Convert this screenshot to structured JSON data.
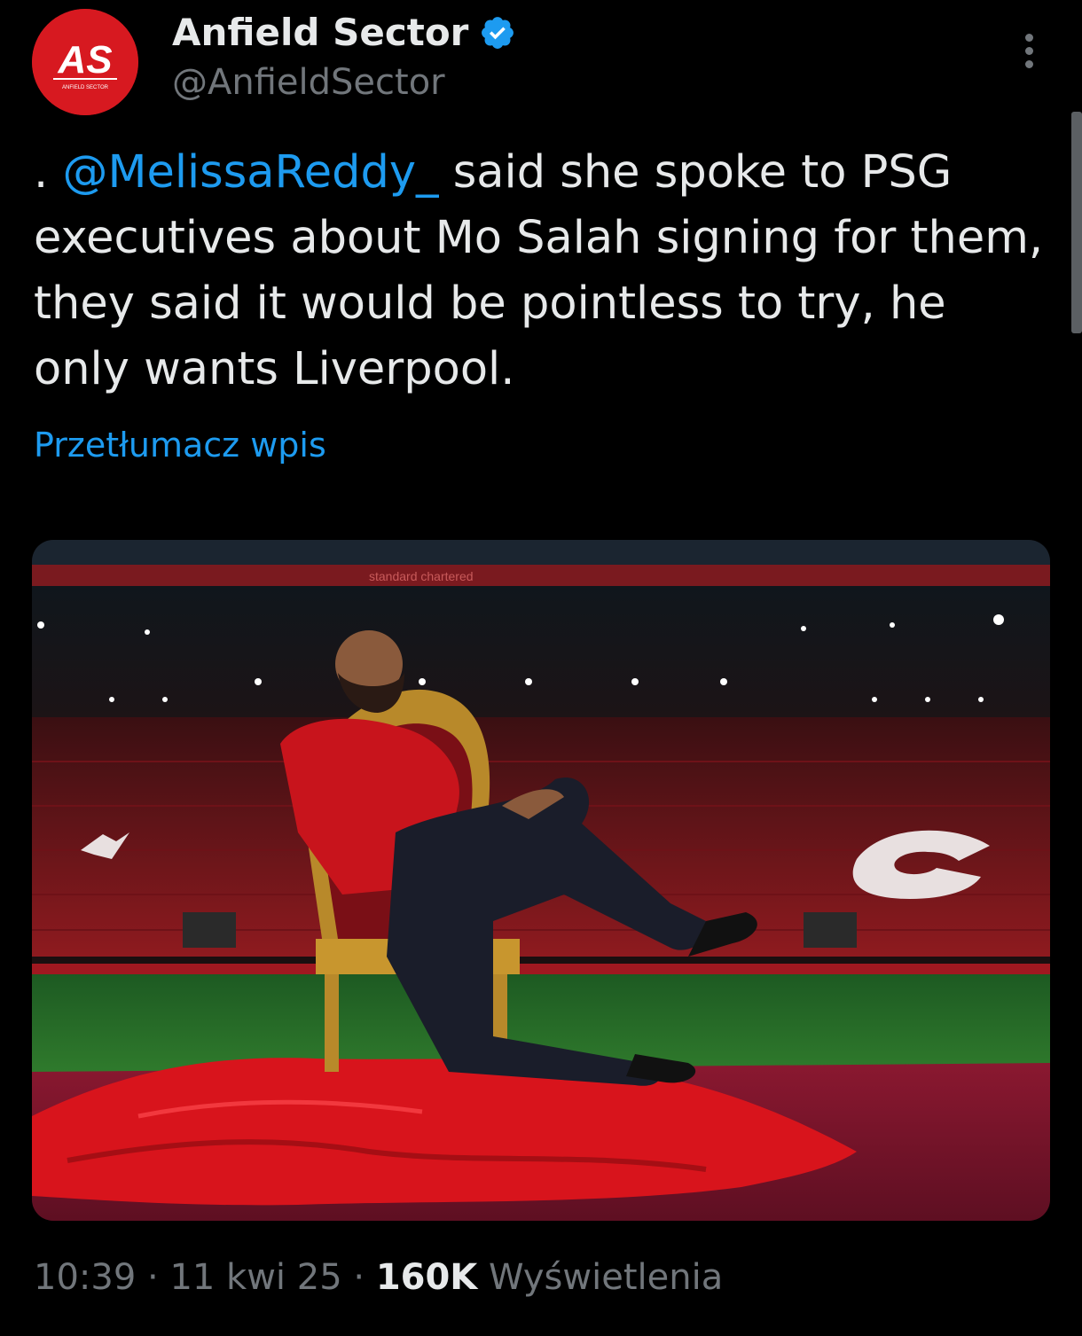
{
  "author": {
    "name": "Anfield Sector",
    "handle": "@AnfieldSector",
    "avatar_monogram": "AS",
    "avatar_caption": "ANFIELD SECTOR",
    "verified_icon": "verified-badge-icon"
  },
  "tweet": {
    "text_prefix": ".",
    "mention": "@MelissaReddy_",
    "text_body": " said she spoke to PSG executives about Mo Salah signing for them, they said it would be pointless to try, he only wants Liverpool.",
    "translate_label": "Przetłumacz wpis"
  },
  "media": {
    "description_icon": "photo",
    "pitch_board_text": "standard chartered"
  },
  "meta": {
    "time": "10:39",
    "date": "11 kwi 25",
    "separator": "·",
    "views_count": "160K",
    "views_label": "Wyświetlenia"
  },
  "colors": {
    "background": "#000000",
    "text": "#e7e9ea",
    "secondary_text": "#71767b",
    "accent": "#1d9bf0",
    "avatar": "#d71920"
  }
}
